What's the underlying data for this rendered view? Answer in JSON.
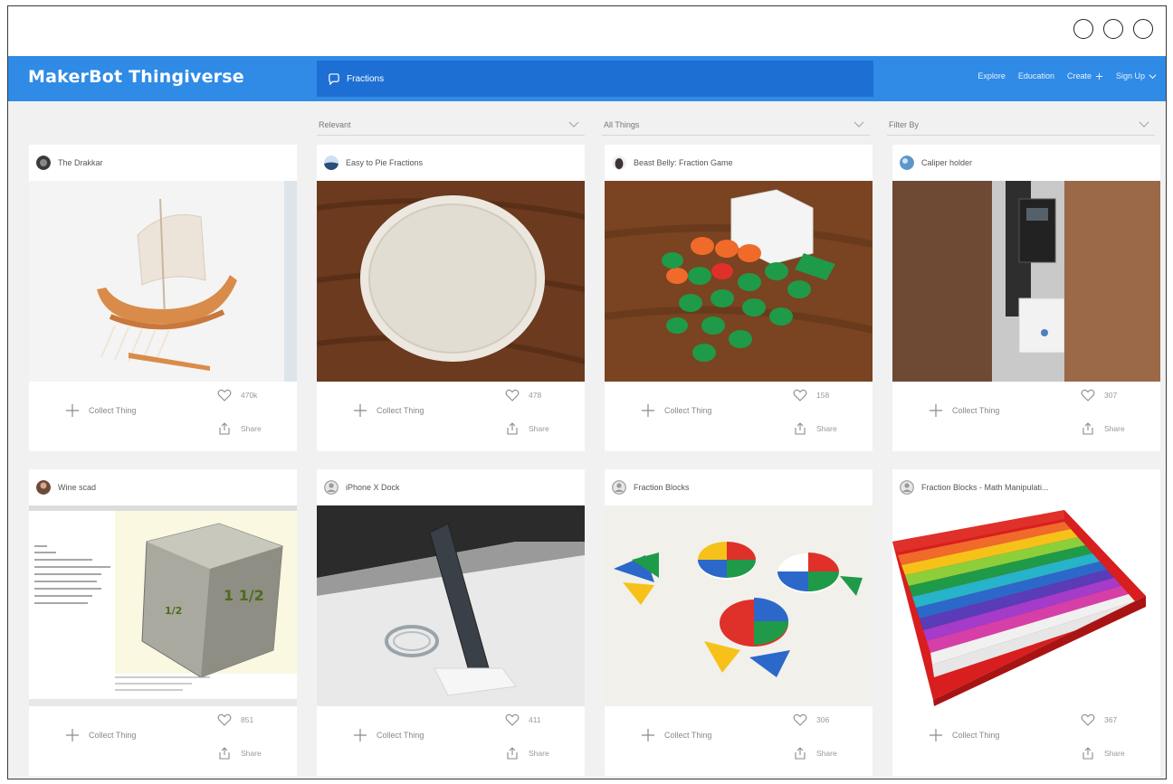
{
  "app": {
    "logo": "MakerBot Thingiverse",
    "search": {
      "value": "Fractions"
    },
    "nav": [
      {
        "label": "Explore",
        "caret": false
      },
      {
        "label": "Education",
        "caret": false
      },
      {
        "label": "Create",
        "caret": true
      },
      {
        "label": "Sign Up",
        "caret": true
      }
    ],
    "colors": {
      "navbar": "#2f8be6",
      "search_bg": "#1d6fd4",
      "page_bg": "#f1f1f1"
    }
  },
  "filters": [
    {
      "label": "Relevant"
    },
    {
      "label": "All Things"
    },
    {
      "label": "Filter By"
    }
  ],
  "cards": [
    {
      "title": "The Drakkar",
      "avatar_icon": "avatar-icon",
      "image": "viking-ship-model",
      "likes": "470k",
      "collect": "Collect Thing",
      "share": "Share"
    },
    {
      "title": "Easy to Pie Fractions",
      "avatar_icon": "avatar-icon",
      "image": "white-fraction-disc",
      "likes": "478",
      "collect": "Collect Thing",
      "share": "Share"
    },
    {
      "title": "Beast Belly: Fraction Game",
      "avatar_icon": "avatar-icon",
      "image": "fraction-game-pieces",
      "likes": "158",
      "collect": "Collect Thing",
      "share": "Share"
    },
    {
      "title": "Caliper holder",
      "avatar_icon": "avatar-icon",
      "image": "caliper-holder",
      "likes": "307",
      "collect": "Collect Thing",
      "share": "Share"
    },
    {
      "title": "Wine scad",
      "avatar_icon": "avatar-icon",
      "image": "cad-cube-render",
      "likes": "851",
      "collect": "Collect Thing",
      "share": "Share"
    },
    {
      "title": "iPhone X Dock",
      "avatar_icon": "avatar-icon",
      "image": "phone-dock",
      "likes": "411",
      "collect": "Collect Thing",
      "share": "Share"
    },
    {
      "title": "Fraction Blocks",
      "avatar_icon": "avatar-icon",
      "image": "fraction-pie-blocks",
      "likes": "306",
      "collect": "Collect Thing",
      "share": "Share"
    },
    {
      "title": "Fraction Blocks - Math Manipulati...",
      "avatar_icon": "avatar-icon",
      "image": "rainbow-fraction-board",
      "likes": "367",
      "collect": "Collect Thing",
      "share": "Share"
    }
  ]
}
